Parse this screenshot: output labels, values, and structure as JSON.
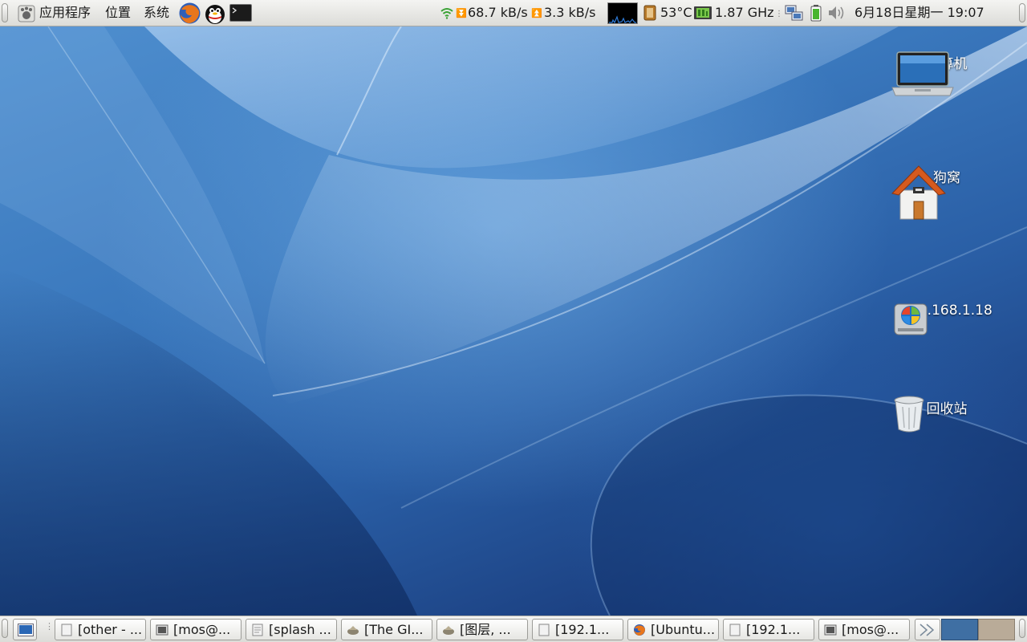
{
  "top_panel": {
    "menus": [
      "应用程序",
      "位置",
      "系统"
    ],
    "net_down": "68.7 kB/s",
    "net_up": "3.3 kB/s",
    "temperature": "53°C",
    "cpu_freq": "1.87 GHz",
    "datetime": "6月18日星期一 19:07"
  },
  "desktop_icons": [
    {
      "label": "计算机",
      "icon": "computer-icon"
    },
    {
      "label": "狗窝",
      "icon": "home-folder-icon"
    },
    {
      "label": "192.168.1.18",
      "icon": "network-drive-icon"
    },
    {
      "label": "回收站",
      "icon": "trash-icon"
    }
  ],
  "taskbar": {
    "tasks": [
      {
        "label": "[other - ...",
        "icon": "document-icon"
      },
      {
        "label": "[mos@...",
        "icon": "terminal-icon"
      },
      {
        "label": "[splash ...",
        "icon": "text-file-icon"
      },
      {
        "label": "[The GI...",
        "icon": "gimp-icon"
      },
      {
        "label": "[图层, ...",
        "icon": "gimp-icon"
      },
      {
        "label": "[192.1...",
        "icon": "document-icon"
      },
      {
        "label": "[Ubuntu...",
        "icon": "firefox-icon"
      },
      {
        "label": "[192.1...",
        "icon": "document-icon"
      },
      {
        "label": "[mos@...",
        "icon": "terminal-icon"
      }
    ]
  },
  "colors": {
    "panel_bg": "#e8e8e4",
    "desktop_blue": "#2f6ab0",
    "active_workspace": "#3f6fa3",
    "inactive_workspace": "#b9ab98"
  }
}
